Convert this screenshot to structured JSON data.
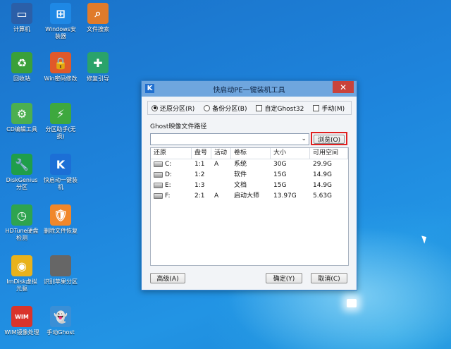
{
  "desktop": {
    "icons": [
      {
        "label": "计算机",
        "glyph": "▭",
        "color": "#2b5fa8"
      },
      {
        "label": "Windows安\n装器",
        "glyph": "⊞",
        "color": "#1e88e5"
      },
      {
        "label": "文件搜索",
        "glyph": "⌕",
        "color": "#e07b2a"
      },
      {
        "label": "回收站",
        "glyph": "♻",
        "color": "#3aa03a"
      },
      {
        "label": "Win密码修改",
        "glyph": "🔒",
        "color": "#e0592a"
      },
      {
        "label": "修复引导",
        "glyph": "✚",
        "color": "#2aa36b"
      },
      {
        "label": "CD编辑工具",
        "glyph": "⚙",
        "color": "#4caf50"
      },
      {
        "label": "分区助手(无\n损)",
        "glyph": "⚡",
        "color": "#3ea83e"
      },
      {
        "label": "DiskGenius\n分区",
        "glyph": "🔧",
        "color": "#1f9e4a"
      },
      {
        "label": "快启动一键装\n机",
        "glyph": "K",
        "color": "#1c6fd6"
      },
      {
        "label": "HDTune硬盘\n检测",
        "glyph": "◷",
        "color": "#2ea44f"
      },
      {
        "label": "删除文件恢复",
        "glyph": "🛡",
        "color": "#f0872a"
      },
      {
        "label": "ImDisk虚拟\n光驱",
        "glyph": "◉",
        "color": "#e8b21c"
      },
      {
        "label": "识别苹果分区",
        "glyph": "",
        "color": "#666666"
      },
      {
        "label": "WIM镜像处理",
        "glyph": "WIM",
        "color": "#d9342b"
      },
      {
        "label": "手动Ghost",
        "glyph": "👻",
        "color": "#3a8fd6"
      }
    ]
  },
  "dialog": {
    "title": "快启动PE一键装机工具",
    "app_icon_letter": "K",
    "close_glyph": "✕",
    "modes": [
      {
        "label": "还原分区(R)",
        "type": "radio",
        "checked": true
      },
      {
        "label": "备份分区(B)",
        "type": "radio",
        "checked": false
      },
      {
        "label": "自定Ghost32",
        "type": "checkbox",
        "checked": false
      },
      {
        "label": "手动(M)",
        "type": "checkbox",
        "checked": false
      }
    ],
    "path_label": "Ghost映像文件路径",
    "path_value": "",
    "combo_arrow": "⌄",
    "browse_label": "浏览(O)",
    "columns": [
      "还原",
      "盘号",
      "活动",
      "卷标",
      "大小",
      "可用空间"
    ],
    "rows": [
      [
        "C:",
        "1:1",
        "A",
        "系统",
        "30G",
        "29.9G"
      ],
      [
        "D:",
        "1:2",
        "",
        "软件",
        "15G",
        "14.9G"
      ],
      [
        "E:",
        "1:3",
        "",
        "文档",
        "15G",
        "14.9G"
      ],
      [
        "F:",
        "2:1",
        "A",
        "启动大师",
        "13.97G",
        "5.63G"
      ]
    ],
    "advanced_label": "高级(A)",
    "ok_label": "确定(Y)",
    "cancel_label": "取消(C)"
  }
}
